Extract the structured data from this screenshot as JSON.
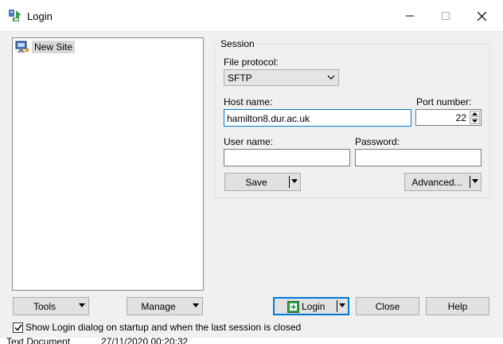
{
  "window": {
    "title": "Login"
  },
  "site_tree": {
    "items": [
      {
        "label": "New Site"
      }
    ]
  },
  "session": {
    "caption": "Session",
    "file_protocol_label": "File protocol:",
    "file_protocol_value": "SFTP",
    "host_name_label": "Host name:",
    "host_name_value": "hamilton8.dur.ac.uk",
    "port_number_label": "Port number:",
    "port_number_value": "22",
    "user_name_label": "User name:",
    "user_name_value": "",
    "password_label": "Password:",
    "password_value": "",
    "save_label": "Save",
    "advanced_label": "Advanced..."
  },
  "buttons": {
    "tools_label": "Tools",
    "manage_label": "Manage",
    "login_label": "Login",
    "close_label": "Close",
    "help_label": "Help"
  },
  "startup_checkbox": {
    "label": "Show Login dialog on startup and when the last session is closed",
    "checked": true
  },
  "background_row": {
    "col1": "Text Document",
    "col2": "27/11/2020  00:20:32"
  },
  "colors": {
    "accent": "#0078d7",
    "login_icon_green": "#2e9e3e"
  }
}
